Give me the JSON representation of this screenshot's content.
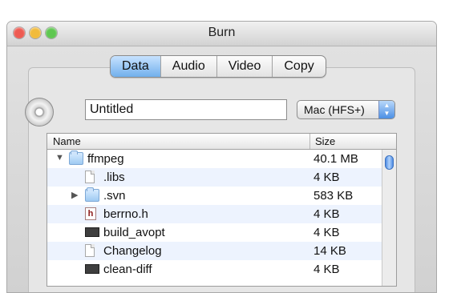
{
  "window": {
    "title": "Burn"
  },
  "tabs": [
    "Data",
    "Audio",
    "Video",
    "Copy"
  ],
  "disc": {
    "name_value": "Untitled",
    "format": "Mac (HFS+)"
  },
  "file_table": {
    "columns": {
      "name": "Name",
      "size": "Size"
    },
    "rows": [
      {
        "name": "ffmpeg",
        "size": "40.1 MB",
        "icon": "folder-icon",
        "depth": 0,
        "disclosure": "▼"
      },
      {
        "name": ".libs",
        "size": "4 KB",
        "icon": "document-icon",
        "depth": 1,
        "disclosure": ""
      },
      {
        "name": ".svn",
        "size": "583 KB",
        "icon": "folder-icon",
        "depth": 1,
        "disclosure": "▶"
      },
      {
        "name": "berrno.h",
        "size": "4 KB",
        "icon": "header-file-icon",
        "depth": 1,
        "disclosure": ""
      },
      {
        "name": "build_avopt",
        "size": "4 KB",
        "icon": "executable-icon",
        "depth": 1,
        "disclosure": ""
      },
      {
        "name": "Changelog",
        "size": "14 KB",
        "icon": "document-icon",
        "depth": 1,
        "disclosure": ""
      },
      {
        "name": "clean-diff",
        "size": "4 KB",
        "icon": "executable-icon",
        "depth": 1,
        "disclosure": ""
      }
    ]
  },
  "colors": {
    "close": "#ee5b52",
    "minimize": "#f1bb3b",
    "zoom": "#5fc751",
    "accent": "#71b0ec",
    "row_alt": "#edf3fe"
  }
}
